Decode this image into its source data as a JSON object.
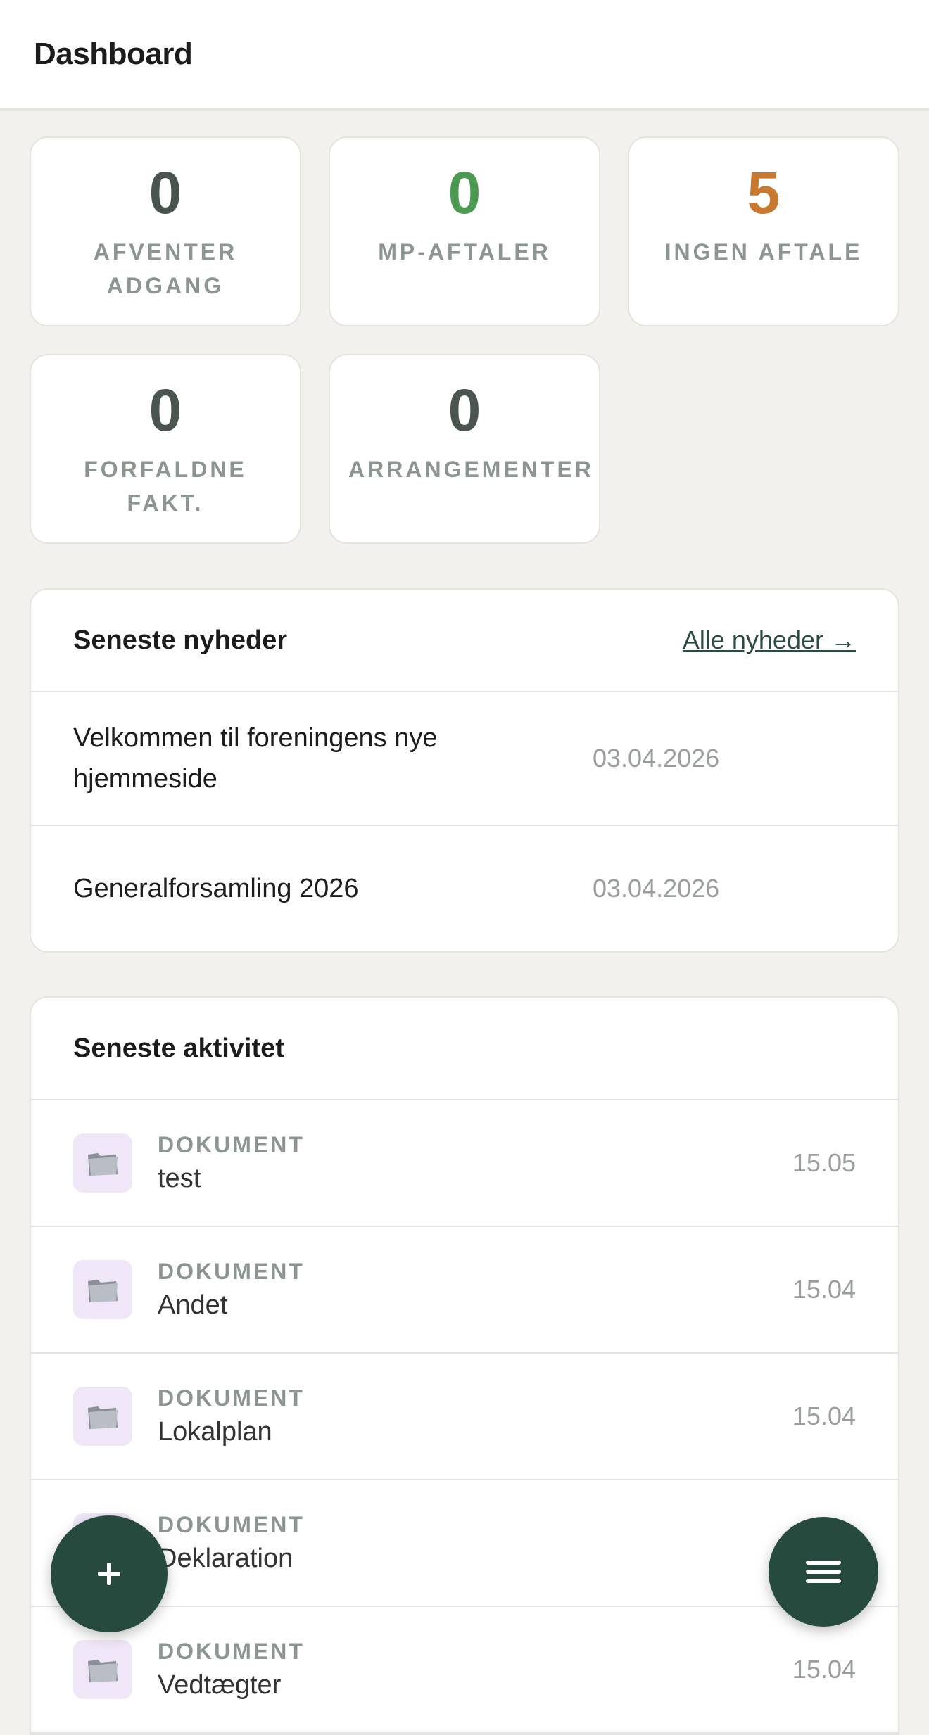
{
  "header": {
    "title": "Dashboard"
  },
  "stats": [
    {
      "value": "0",
      "label": "AFVENTER ADGANG",
      "color": "#4a5550"
    },
    {
      "value": "0",
      "label": "MP-AFTALER",
      "color": "#4c9a52"
    },
    {
      "value": "5",
      "label": "INGEN AFTALE",
      "color": "#c9782f"
    },
    {
      "value": "0",
      "label": "FORFALDNE FAKT.",
      "color": "#4a5550"
    },
    {
      "value": "0",
      "label": "ARRANGEMENTER",
      "color": "#4a5550"
    }
  ],
  "news": {
    "heading": "Seneste nyheder",
    "all_link": "Alle nyheder →",
    "items": [
      {
        "title": "Velkommen til foreningens nye hjemmeside",
        "date": "03.04.2026"
      },
      {
        "title": "Generalforsamling 2026",
        "date": "03.04.2026"
      }
    ]
  },
  "activity": {
    "heading": "Seneste aktivitet",
    "items": [
      {
        "type": "DOKUMENT",
        "name": "test",
        "date": "15.05",
        "icon": "folder-icon"
      },
      {
        "type": "DOKUMENT",
        "name": "Andet",
        "date": "15.04",
        "icon": "folder-icon"
      },
      {
        "type": "DOKUMENT",
        "name": "Lokalplan",
        "date": "15.04",
        "icon": "folder-icon"
      },
      {
        "type": "DOKUMENT",
        "name": "Deklaration",
        "date": "",
        "icon": "folder-icon"
      },
      {
        "type": "DOKUMENT",
        "name": "Vedtægter",
        "date": "15.04",
        "icon": "folder-icon"
      }
    ]
  },
  "fab_add": {
    "icon": "plus-icon",
    "symbol": "+"
  },
  "fab_menu": {
    "icon": "menu-icon"
  }
}
